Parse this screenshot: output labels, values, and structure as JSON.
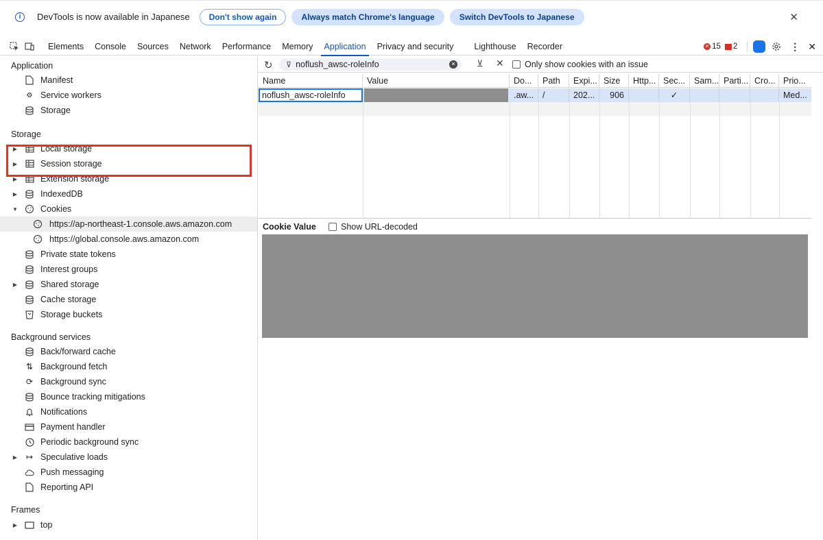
{
  "infobar": {
    "message": "DevTools is now available in Japanese",
    "btn_dont_show": "Don't show again",
    "btn_always_match": "Always match Chrome's language",
    "btn_switch": "Switch DevTools to Japanese"
  },
  "tabs": [
    "Elements",
    "Console",
    "Sources",
    "Network",
    "Performance",
    "Memory",
    "Application",
    "Privacy and security",
    "Lighthouse",
    "Recorder"
  ],
  "active_tab": "Application",
  "status": {
    "errors": "15",
    "issues": "2"
  },
  "sidebar": {
    "app_title": "Application",
    "app_items": [
      "Manifest",
      "Service workers",
      "Storage"
    ],
    "storage_title": "Storage",
    "storage_items": [
      "Local storage",
      "Session storage",
      "Extension storage",
      "IndexedDB",
      "Cookies"
    ],
    "cookie_origins": [
      "https://ap-northeast-1.console.aws.amazon.com",
      "https://global.console.aws.amazon.com"
    ],
    "storage_items2": [
      "Private state tokens",
      "Interest groups",
      "Shared storage",
      "Cache storage",
      "Storage buckets"
    ],
    "bg_title": "Background services",
    "bg_items": [
      "Back/forward cache",
      "Background fetch",
      "Background sync",
      "Bounce tracking mitigations",
      "Notifications",
      "Payment handler",
      "Periodic background sync",
      "Speculative loads",
      "Push messaging",
      "Reporting API"
    ],
    "frames_title": "Frames",
    "frames_items": [
      "top"
    ]
  },
  "toolbar": {
    "filter_value": "noflush_awsc-roleInfo",
    "only_issue_label": "Only show cookies with an issue"
  },
  "table": {
    "headers": [
      "Name",
      "Value",
      "Do...",
      "Path",
      "Expi...",
      "Size",
      "Http...",
      "Sec...",
      "Sam...",
      "Parti...",
      "Cro...",
      "Prio..."
    ],
    "row": {
      "name": "noflush_awsc-roleInfo",
      "domain": ".aw...",
      "path": "/",
      "expires": "202...",
      "size": "906",
      "secure": "✓",
      "priority": "Med..."
    }
  },
  "cookie_value": {
    "label": "Cookie Value",
    "decode_label": "Show URL-decoded"
  }
}
